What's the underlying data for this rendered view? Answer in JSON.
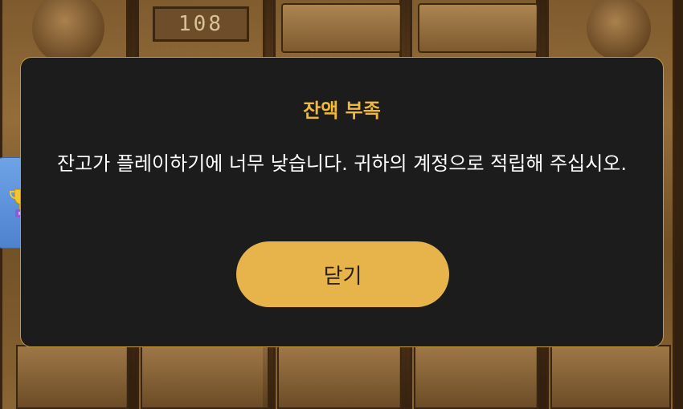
{
  "background": {
    "counter_value": "108"
  },
  "side_tab": {
    "icon": "trophy-icon"
  },
  "modal": {
    "title": "잔액 부족",
    "message": "잔고가 플레이하기에 너무 낮습니다. 귀하의 계정으로 적립해 주십시오.",
    "close_label": "닫기"
  },
  "colors": {
    "accent": "#e6b44a",
    "title": "#f0b93a",
    "modal_bg": "#1c1c1c",
    "modal_border": "#c69a3a"
  }
}
